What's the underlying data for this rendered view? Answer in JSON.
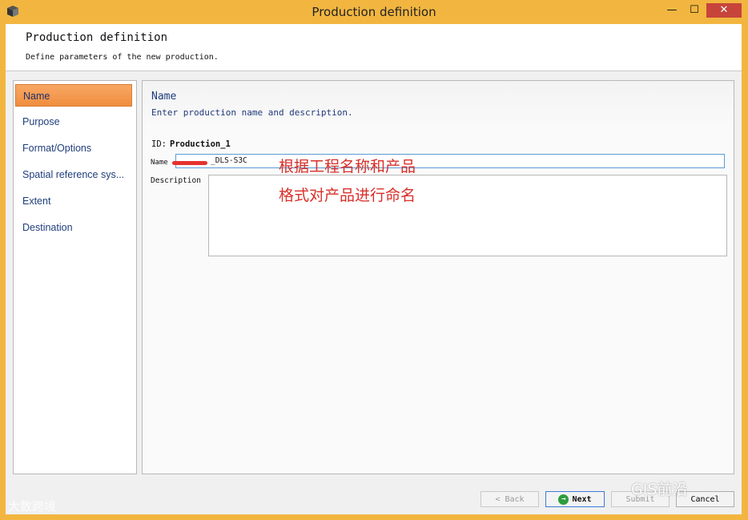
{
  "window": {
    "title": "Production definition",
    "minimize_glyph": "—",
    "maximize_glyph": "☐",
    "close_glyph": "✕"
  },
  "header": {
    "title": "Production definition",
    "subtitle": "Define parameters of the new production."
  },
  "sidebar": {
    "items": [
      {
        "label": "Name",
        "active": true
      },
      {
        "label": "Purpose",
        "active": false
      },
      {
        "label": "Format/Options",
        "active": false
      },
      {
        "label": "Spatial reference sys...",
        "active": false
      },
      {
        "label": "Extent",
        "active": false
      },
      {
        "label": "Destination",
        "active": false
      }
    ]
  },
  "panel": {
    "title": "Name",
    "subtitle": "Enter production name and description.",
    "id_label": "ID:",
    "id_value": "Production_1",
    "name_label": "Name",
    "name_value": "_DLS-S3C",
    "description_label": "Description",
    "description_value": ""
  },
  "annotation": {
    "line1": "根据工程名称和产品",
    "line2": "格式对产品进行命名",
    "color": "#d9302a"
  },
  "buttons": {
    "back": "< Back",
    "next": "Next",
    "submit": "Submit",
    "cancel": "Cancel"
  },
  "watermarks": {
    "left": "大数跨境",
    "right": "GIS前沿"
  },
  "colors": {
    "titlebar": "#f2b640",
    "active_nav": "#f08d3e",
    "nav_text": "#203e7c",
    "close_button": "#c7443a"
  }
}
